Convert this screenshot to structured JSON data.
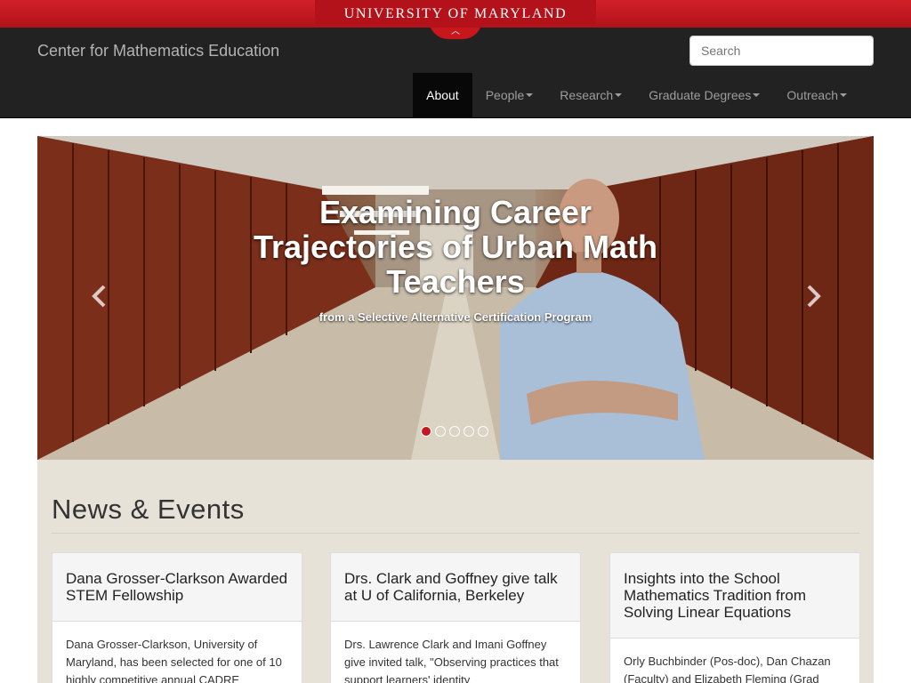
{
  "umd": {
    "title": "UNIVERSITY OF MARYLAND"
  },
  "nav": {
    "brand": "Center for Mathematics Education",
    "search_placeholder": "Search",
    "items": [
      {
        "label": "About",
        "active": true,
        "dropdown": false
      },
      {
        "label": "People",
        "dropdown": true
      },
      {
        "label": "Research",
        "dropdown": true
      },
      {
        "label": "Graduate Degrees",
        "dropdown": true
      },
      {
        "label": "Outreach",
        "dropdown": true
      }
    ]
  },
  "carousel": {
    "title": "Examining Career Trajectories of Urban Math Teachers",
    "subtitle": "from a Selective Alternative Certification Program",
    "slide_count": 5,
    "active_slide": 1
  },
  "news": {
    "heading": "News & Events",
    "cards": [
      {
        "title": "Dana Grosser-Clarkson Awarded STEM Fellowship",
        "body": "Dana Grosser-Clarkson, University of Maryland, has been selected for one of 10 highly competitive annual CADRE"
      },
      {
        "title": "Drs. Clark and Goffney give talk at U of California, Berkeley",
        "body": "Drs. Lawrence Clark and Imani Goffney give invited talk, \"Observing practices that support learners' identity"
      },
      {
        "title": "Insights into the School Mathematics Tradition from Solving Linear Equations",
        "body": "Orly Buchbinder (Pos-doc), Dan Chazan (Faculty) and Elizabeth Fleming (Grad"
      }
    ]
  },
  "colors": {
    "umd_red": "#c8161d",
    "nav_bg": "#222222",
    "news_bg": "#e6e2d8"
  }
}
